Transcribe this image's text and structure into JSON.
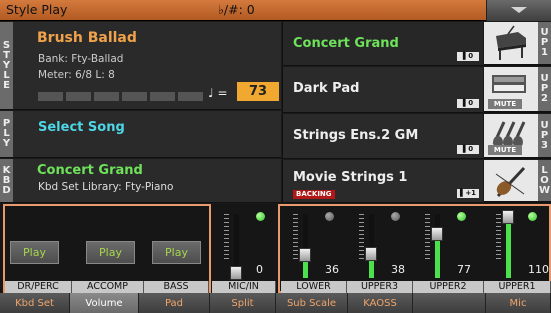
{
  "header": {
    "title": "Style Play",
    "key_signature": "♭/#: 0",
    "menu_icon": "chevron-down-icon"
  },
  "style_section": {
    "label": "STYLE",
    "style_name": "Brush Ballad",
    "bank": "Bank: Fty-Ballad",
    "meter": "Meter: 6/8 L:  8",
    "tempo_symbol": "♩ =",
    "tempo": "73"
  },
  "play_section": {
    "label": "PLY",
    "song": "Select Song"
  },
  "kbd_section": {
    "label": "KBD",
    "kbd_set": "Concert Grand",
    "library": "Kbd Set Library: Fty-Piano"
  },
  "sound_slots": [
    {
      "name": "Concert Grand",
      "octave": "▌0",
      "icon": "piano-icon",
      "mute": "",
      "side": "UP1",
      "status": ""
    },
    {
      "name": "Dark Pad",
      "octave": "▌0",
      "icon": "synth-keyboard-icon",
      "mute": "MUTE",
      "side": "UP2",
      "status": ""
    },
    {
      "name": "Strings Ens.2 GM",
      "octave": "▌0",
      "icon": "violins-icon",
      "mute": "MUTE",
      "side": "UP3",
      "status": ""
    },
    {
      "name": "Movie Strings 1",
      "octave": "▌+1",
      "icon": "violin-icon",
      "mute": "",
      "side": "LOW",
      "status": "BACKING"
    }
  ],
  "mixer": {
    "play_channels": [
      {
        "button": "Play",
        "label": "DR/PERC"
      },
      {
        "button": "Play",
        "label": "ACCOMP"
      },
      {
        "button": "Play",
        "label": "BASS"
      }
    ],
    "faders": [
      {
        "label": "MIC/IN",
        "value": "0",
        "level": 0.0,
        "led": "on"
      },
      {
        "label": "LOWER",
        "value": "36",
        "level": 0.28,
        "led": "off"
      },
      {
        "label": "UPPER3",
        "value": "38",
        "level": 0.3,
        "led": "off"
      },
      {
        "label": "UPPER2",
        "value": "77",
        "level": 0.61,
        "led": "on"
      },
      {
        "label": "UPPER1",
        "value": "110",
        "level": 0.87,
        "led": "on"
      }
    ]
  },
  "tabs": [
    {
      "label": "Kbd Set"
    },
    {
      "label": "Volume"
    },
    {
      "label": "Pad"
    },
    {
      "label": "Split"
    },
    {
      "label": "Sub Scale"
    },
    {
      "label": "KAOSS"
    },
    {
      "label": ""
    },
    {
      "label": "Mic"
    }
  ],
  "colors": {
    "accent": "#f0a24a",
    "header": "#c76b30",
    "play_text": "#a5d64a",
    "fader_green": "#4ce04c",
    "group_outline": "#e79a6c"
  }
}
